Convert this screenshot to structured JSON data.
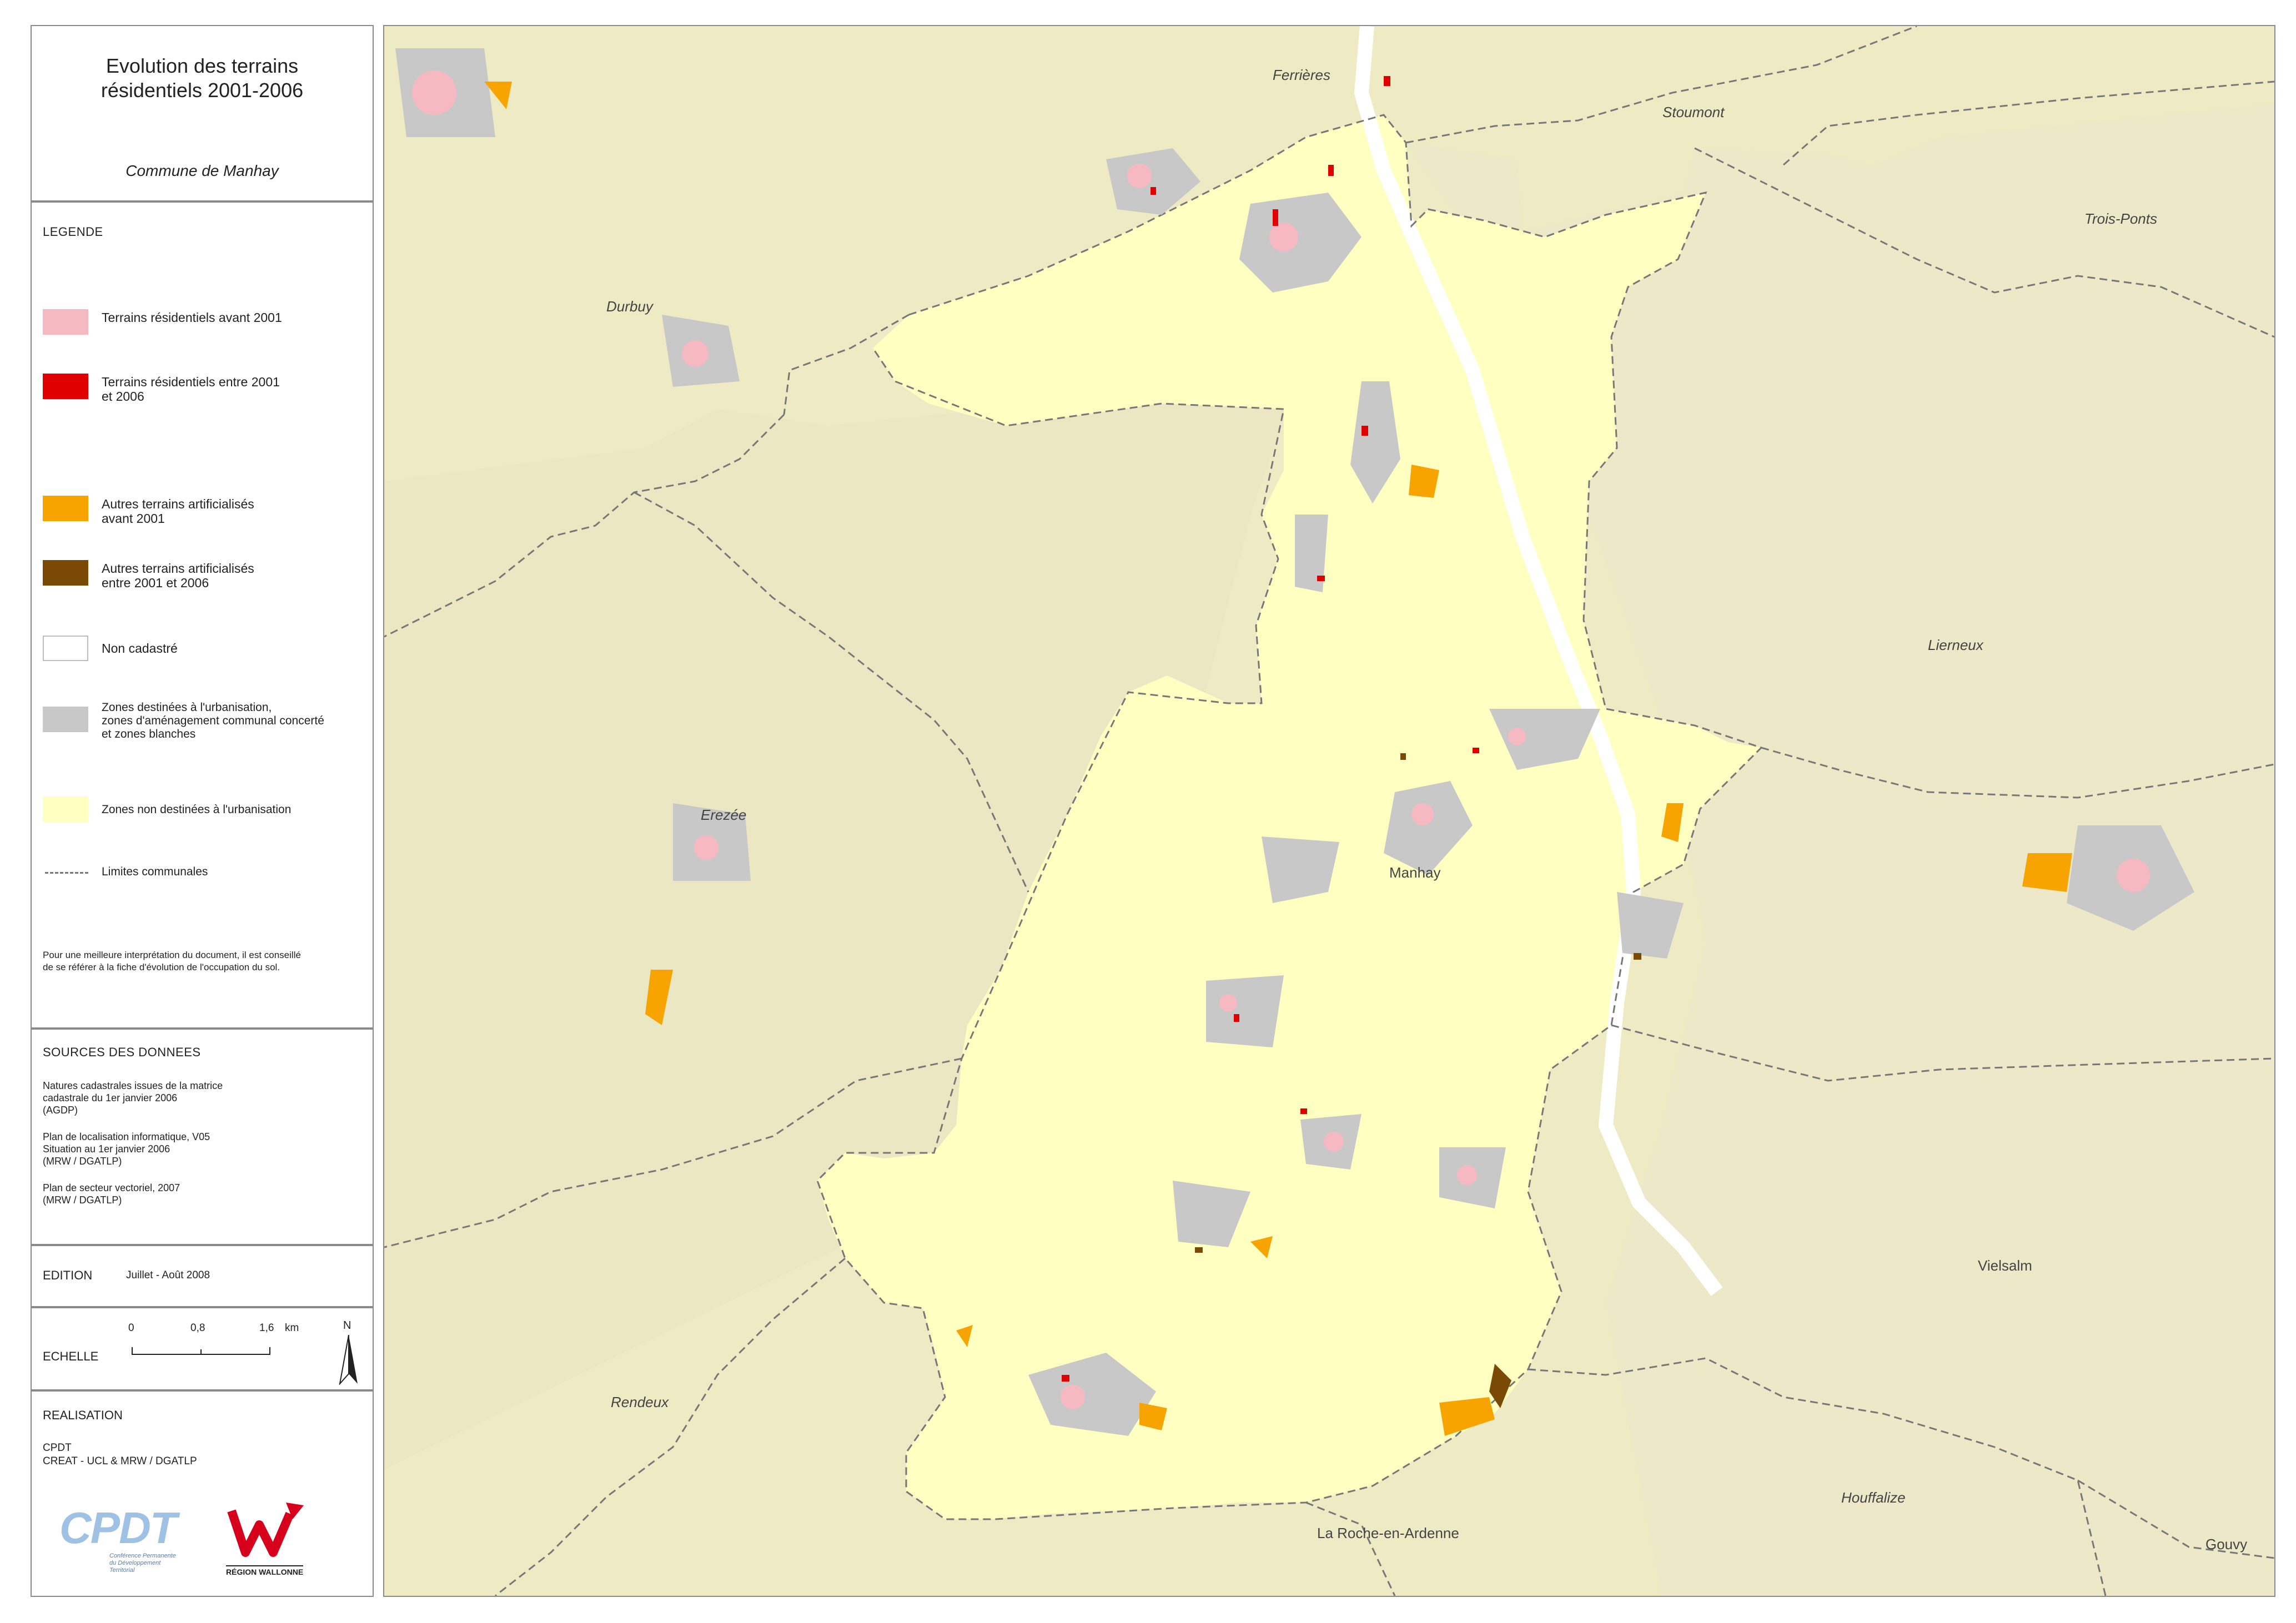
{
  "title": {
    "main_line1": "Evolution des terrains",
    "main_line2": "résidentiels 2001-2006",
    "commune": "Commune de Manhay"
  },
  "legend": {
    "header": "LEGENDE",
    "items": [
      {
        "label_line1": "Terrains résidentiels avant 2001",
        "label_line2": "",
        "color": "#f7b9c1"
      },
      {
        "label_line1": "Terrains résidentiels entre 2001",
        "label_line2": "et 2006",
        "color": "#e10000"
      },
      {
        "label_line1": "Autres terrains artificialisés",
        "label_line2": "avant 2001",
        "color": "#f7a400"
      },
      {
        "label_line1": "Autres terrains artificialisés",
        "label_line2": "entre 2001 et 2006",
        "color": "#7a4a05"
      },
      {
        "label_line1": "Non cadastré",
        "label_line2": "",
        "color": "#ffffff"
      },
      {
        "label_line1": "Zones destinées à l'urbanisation,",
        "label_line2": "zones d'aménagement communal concerté",
        "label_line3": "et zones blanches",
        "color": "#c8c8c8"
      },
      {
        "label_line1": "Zones non destinées à l'urbanisation",
        "label_line2": "",
        "color": "#ffffc2"
      },
      {
        "label_line1": "Limites communales",
        "label_line2": "",
        "color": "#777777"
      }
    ],
    "note_line1": "Pour une meilleure interprétation du document, il est conseillé",
    "note_line2": "de se référer à la fiche d'évolution de l'occupation du sol."
  },
  "sources": {
    "header": "SOURCES DES DONNEES",
    "blocks": [
      [
        "Natures cadastrales issues de la matrice",
        "cadastrale du 1er janvier 2006",
        "(AGDP)"
      ],
      [
        "Plan de localisation informatique, V05",
        "Situation au 1er janvier 2006",
        "(MRW / DGATLP)"
      ],
      [
        "Plan de secteur vectoriel, 2007",
        "(MRW / DGATLP)"
      ]
    ]
  },
  "edition": {
    "label": "EDITION",
    "value": "Juillet - Août 2008"
  },
  "scale": {
    "label": "ECHELLE",
    "ticks": [
      "0",
      "0,8",
      "1,6"
    ],
    "unit": "km",
    "north": "N"
  },
  "realisation": {
    "label": "REALISATION",
    "line1": "CPDT",
    "line2": "CREAT - UCL & MRW / DGATLP",
    "cpdt_logo_text": "CPDT",
    "cpdt_logo_sub1": "Conférence Permanente",
    "cpdt_logo_sub2": "du Développement",
    "cpdt_logo_sub3": "Territorial",
    "rw_logo_text": "RÉGION WALLONNE"
  },
  "map": {
    "places": {
      "ferrieres": "Ferrières",
      "stoumont": "Stoumont",
      "trois_ponts": "Trois-Ponts",
      "durbuy": "Durbuy",
      "lierneux": "Lierneux",
      "erezee": "Erezée",
      "manhay": "Manhay",
      "vielsalm": "Vielsalm",
      "rendeux": "Rendeux",
      "houffalize": "Houffalize",
      "la_roche": "La Roche-en-Ardenne",
      "gouvy": "Gouvy"
    },
    "colors": {
      "background": "#f1edc7",
      "commune": "#ffffc2",
      "urban_zone": "#c8c8c8",
      "resid_before": "#f7b9c1",
      "resid_new": "#e10000",
      "other_before": "#f7a400",
      "other_new": "#7a4a05",
      "boundary": "#777777"
    }
  }
}
